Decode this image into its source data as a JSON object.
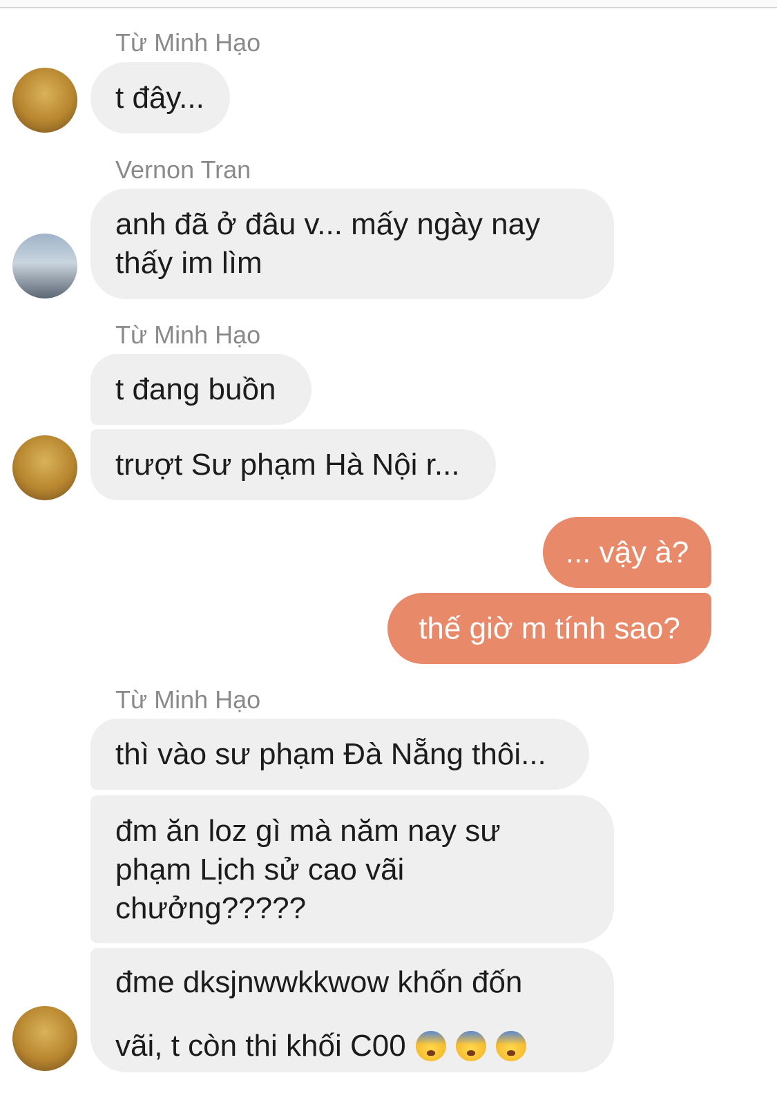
{
  "messages": [
    {
      "sender": "Từ Minh Hạo",
      "text": "t đây..."
    },
    {
      "sender": "Vernon Tran",
      "line1": "anh đã ở đâu v... mấy ngày nay",
      "line2": "thấy im lìm"
    },
    {
      "sender": "Từ Minh Hạo",
      "text1": "t đang buồn",
      "text2": "trượt Sư phạm Hà Nội r..."
    },
    {
      "outgoing1": "... vậy à?",
      "outgoing2": "thế giờ m tính sao?"
    },
    {
      "sender": "Từ Minh Hạo",
      "text1": "thì vào sư phạm Đà Nẵng thôi...",
      "text2_l1": "đm ăn loz gì mà năm nay sư",
      "text2_l2": "phạm Lịch sử cao vãi",
      "text2_l3": "chưởng?????",
      "text3_l1": "đme dksjnwwkkwow khốn đốn",
      "text3_l2": "vãi, t còn thi khối C00"
    }
  ],
  "emoji_name": "anxious-face-with-sweat-icon",
  "colors": {
    "incoming_bubble": "#efefef",
    "outgoing_bubble": "#e8896a",
    "sender_name": "#8a8a8a"
  }
}
